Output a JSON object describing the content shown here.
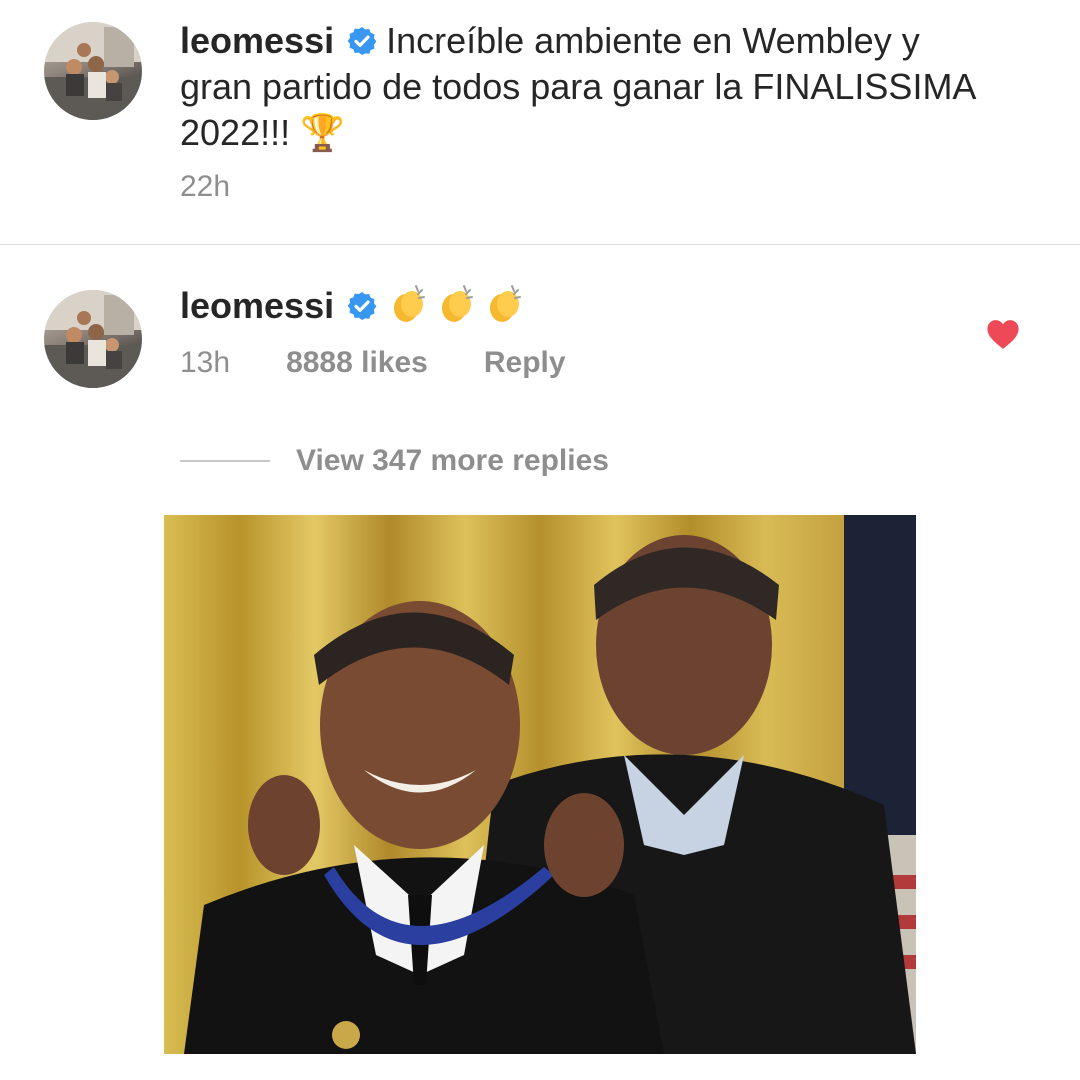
{
  "post": {
    "username": "leomessi",
    "verified_icon": "verified-badge-icon",
    "caption": "Increíble ambiente en Wembley y gran partido de todos para ganar la FINALISSIMA 2022!!! 🏆",
    "time": "22h"
  },
  "comment": {
    "username": "leomessi",
    "emojis": "👏👏👏",
    "time": "13h",
    "likes": "8888 likes",
    "reply_label": "Reply",
    "liked": true,
    "heart_color": "#ed4956",
    "view_replies": "View 347 more replies",
    "image_alt": "Meme photo: man placing a medal on himself"
  },
  "colors": {
    "text": "#262626",
    "secondary": "#8e8e8e",
    "verified": "#3897f0"
  }
}
